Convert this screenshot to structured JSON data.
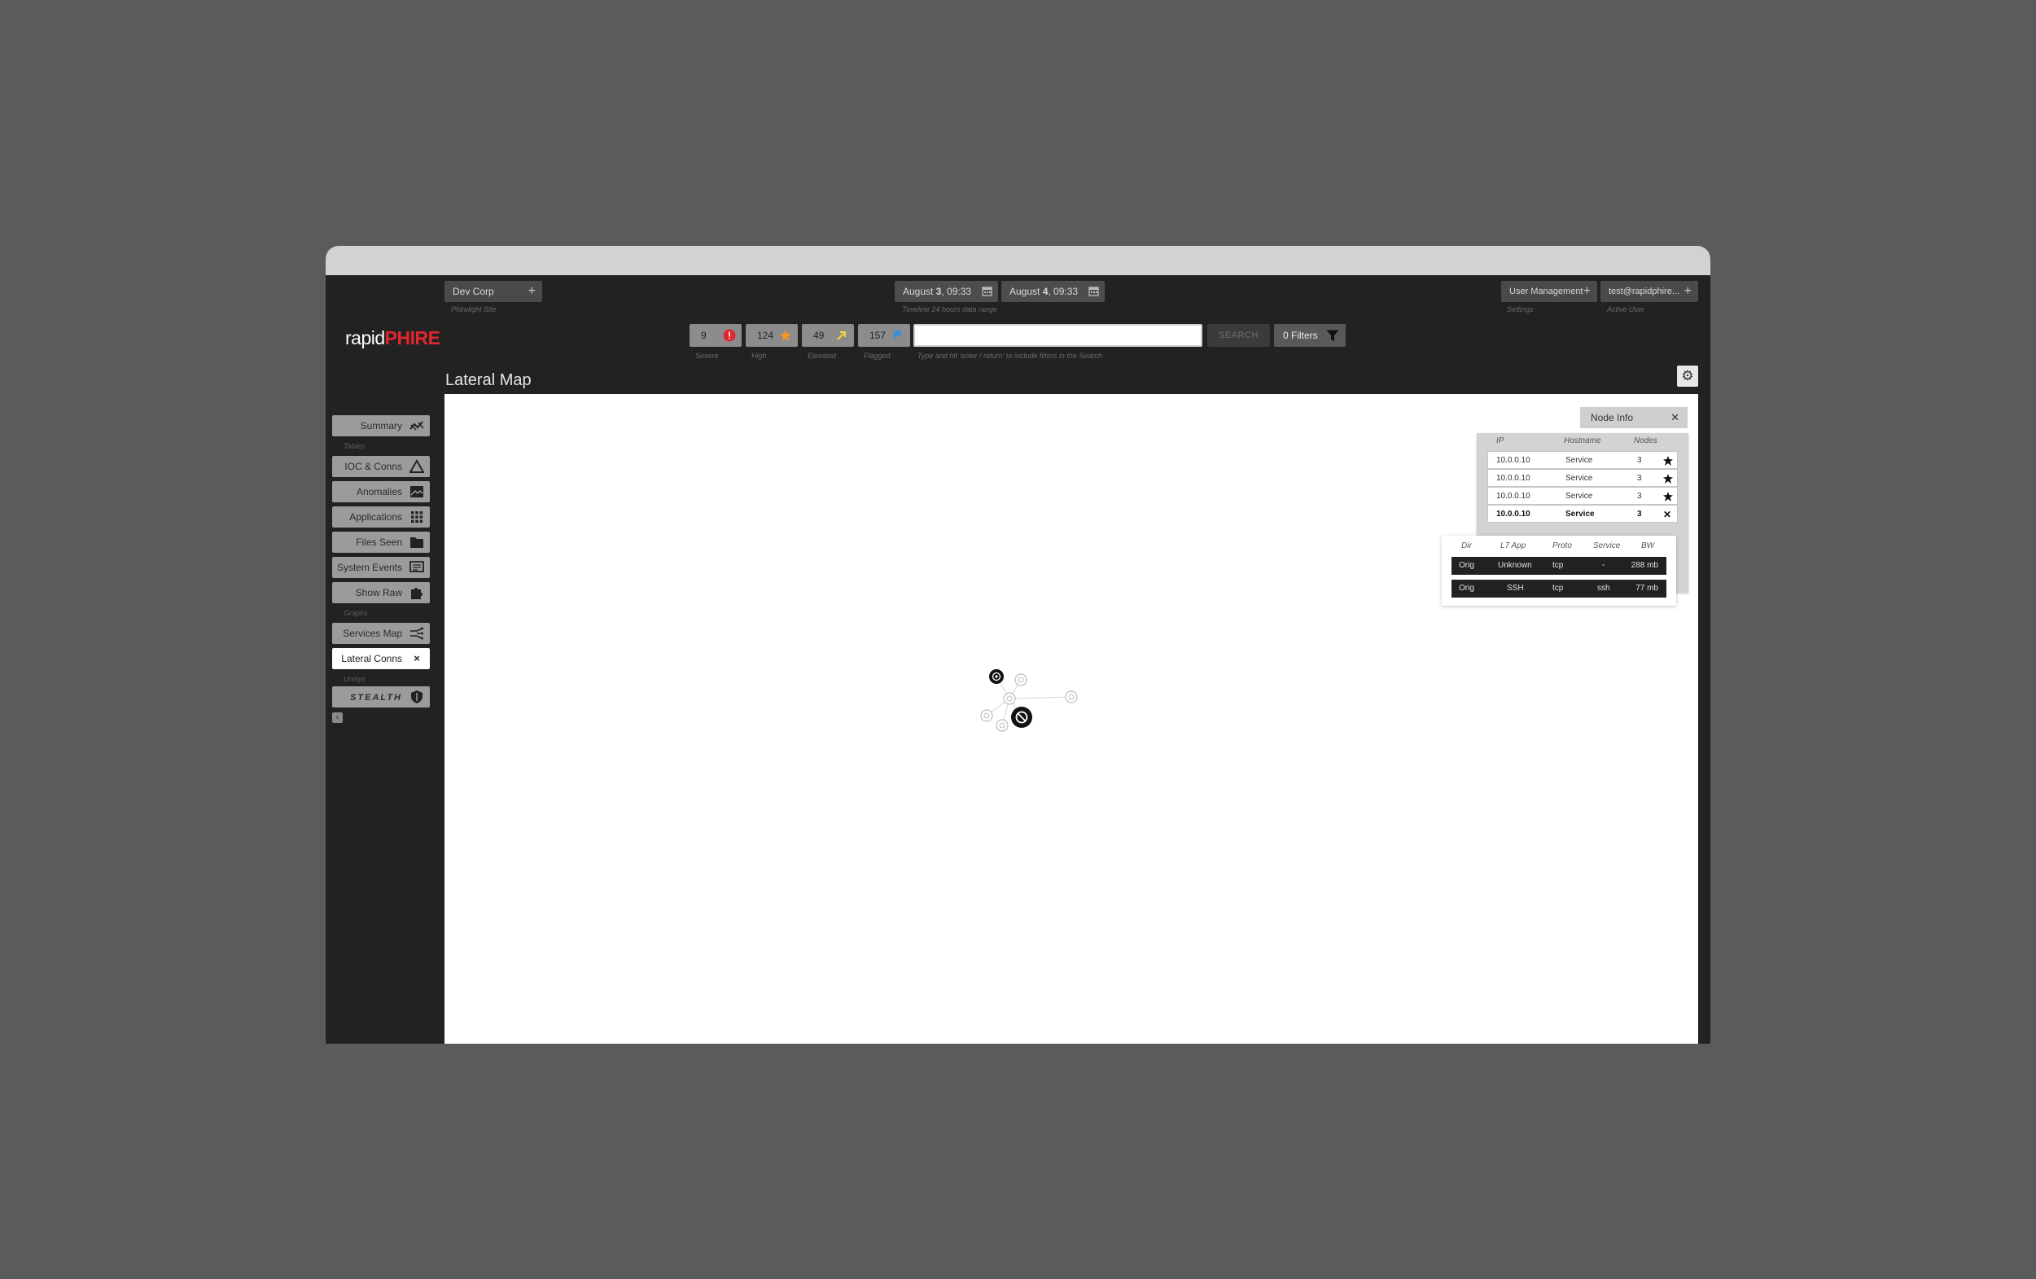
{
  "top": {
    "site": {
      "value": "Dev Corp",
      "sub": "Phirelight Site"
    },
    "date_from": {
      "month": "August ",
      "day": "3",
      "time": ", 09:33"
    },
    "date_to": {
      "month": "August ",
      "day": "4",
      "time": ", 09:33"
    },
    "timeline_sub": "Timeline 24 hours data range",
    "settings": {
      "value": "User Management",
      "sub": "Settings"
    },
    "user": {
      "value": "test@rapidphire...",
      "sub": "Active User"
    }
  },
  "logo": {
    "part1": "rapid",
    "part2": "PHIRE"
  },
  "severity": [
    {
      "value": "9",
      "label": "Severe",
      "icon": "alert-circle-icon",
      "color": "#e2262f"
    },
    {
      "value": "124",
      "label": "High",
      "icon": "star-icon",
      "color": "#f7931e"
    },
    {
      "value": "49",
      "label": "Elevated",
      "icon": "arrow-up-right-icon",
      "color": "#f0d43a"
    },
    {
      "value": "157",
      "label": "Flagged",
      "icon": "flag-icon",
      "color": "#3b8fd9"
    }
  ],
  "search": {
    "placeholder": "",
    "hint": "Type and hit 'enter / return' to include filters in the Search.",
    "button": "SEARCH",
    "filters": "0 Filters"
  },
  "page": {
    "title": "Lateral Map"
  },
  "sidebar": {
    "summary": "Summary",
    "cat_tables": "Tables",
    "ioc": "IOC & Conns",
    "anomalies": "Anomalies",
    "applications": "Applications",
    "files": "Files Seen",
    "system_events": "System Events",
    "show_raw": "Show Raw",
    "cat_graphs": "Graphs",
    "services_map": "Services Map",
    "lateral_conns": "Lateral Conns",
    "cat_unisys": "Unisys",
    "stealth": "STEALTH"
  },
  "node_info": {
    "title": "Node Info",
    "headers": {
      "ip": "IP",
      "hostname": "Hostname",
      "nodes": "Nodes"
    },
    "rows": [
      {
        "ip": "10.0.0.10",
        "hostname": "Service",
        "nodes": "3"
      },
      {
        "ip": "10.0.0.10",
        "hostname": "Service",
        "nodes": "3"
      },
      {
        "ip": "10.0.0.10",
        "hostname": "Service",
        "nodes": "3"
      },
      {
        "ip": "10.0.0.10",
        "hostname": "Service",
        "nodes": "3"
      }
    ]
  },
  "connections": {
    "headers": {
      "dir": "Dir",
      "app": "L7 App",
      "proto": "Proto",
      "service": "Service",
      "bw": "BW"
    },
    "rows": [
      {
        "dir": "Orig",
        "app": "Unknown",
        "proto": "tcp",
        "service": "-",
        "bw": "288 mb"
      },
      {
        "dir": "Orig",
        "app": "SSH",
        "proto": "tcp",
        "service": "ssh",
        "bw": "77 mb"
      }
    ]
  }
}
